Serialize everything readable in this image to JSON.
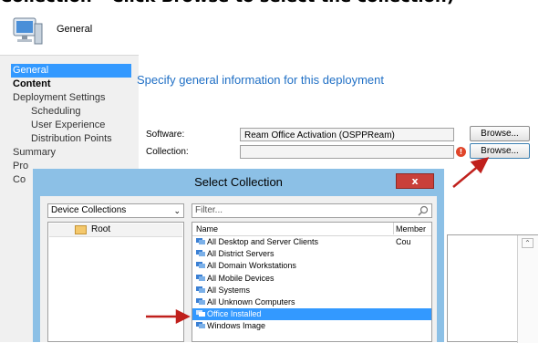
{
  "top_caption": "Collection – Click Browse to select the collection)",
  "wizard": {
    "header_title": "General",
    "nav": [
      {
        "label": "General",
        "state": "selected"
      },
      {
        "label": "Content",
        "state": "bold"
      },
      {
        "label": "Deployment Settings",
        "state": "normal"
      },
      {
        "label": "Scheduling",
        "state": "sub"
      },
      {
        "label": "User Experience",
        "state": "sub"
      },
      {
        "label": "Distribution Points",
        "state": "sub"
      },
      {
        "label": "Summary",
        "state": "normal"
      },
      {
        "label": "Pro",
        "state": "normal"
      },
      {
        "label": "Co",
        "state": "normal"
      }
    ],
    "heading": "Specify general information for this deployment",
    "software_label": "Software:",
    "software_value": "Ream Office Activation (OSPPReam)",
    "collection_label": "Collection:",
    "collection_value": "",
    "browse_label": "Browse...",
    "error_glyph": "!"
  },
  "dialog": {
    "title": "Select Collection",
    "close_glyph": "x",
    "type_selected": "Device Collections",
    "tree_root": "Root",
    "filter_placeholder": "Filter...",
    "col_name": "Name",
    "col_member": "Member Cou",
    "items": [
      "All Desktop and Server Clients",
      "All District Servers",
      "All Domain Workstations",
      "All Mobile Devices",
      "All Systems",
      "All Unknown Computers",
      "Office Installed",
      "Windows Image"
    ],
    "selected_item": "Office Installed"
  },
  "colors": {
    "accent": "#3399ff",
    "heading": "#1f6fc5",
    "arrow": "#c0201c",
    "dialog_frame": "#8cc0e6",
    "close": "#c9403a"
  }
}
